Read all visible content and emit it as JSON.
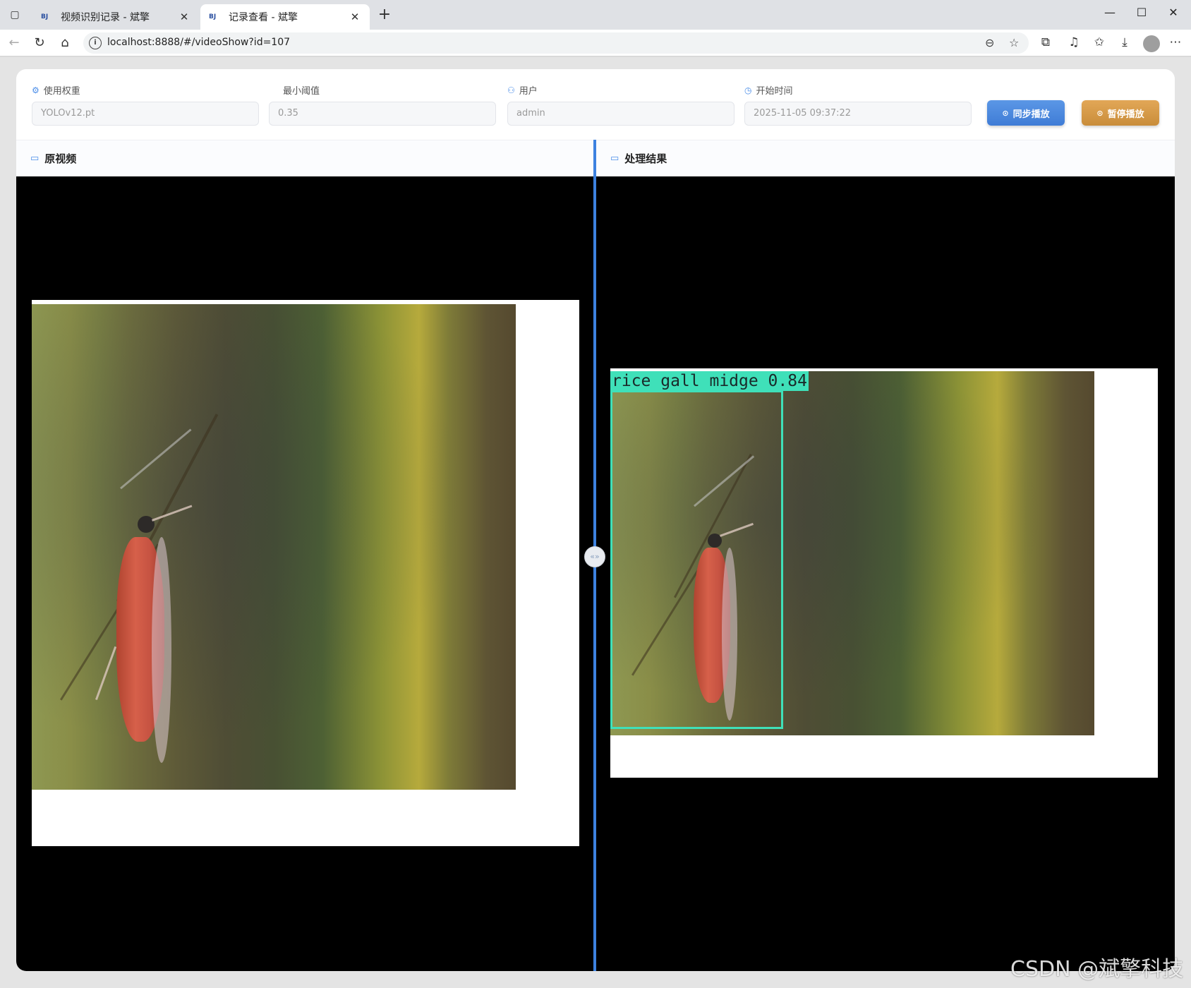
{
  "browser": {
    "tabs": [
      {
        "favicon": "BJ",
        "title": "视频识别记录 - 斌擎",
        "active": false
      },
      {
        "favicon": "BJ",
        "title": "记录查看 - 斌擎",
        "active": true
      }
    ],
    "address": "localhost:8888/#/videoShow?id=107"
  },
  "form": {
    "weight": {
      "label": "使用权重",
      "value": "YOLOv12.pt",
      "icon": "cpu-icon"
    },
    "threshold": {
      "label": "最小阈值",
      "value": "0.35"
    },
    "user": {
      "label": "用户",
      "value": "admin",
      "icon": "user-icon"
    },
    "start_time": {
      "label": "开始时间",
      "value": "2025-11-05 09:37:22",
      "icon": "clock-icon"
    }
  },
  "buttons": {
    "sync": "同步播放",
    "pause": "暂停播放"
  },
  "panels": {
    "original": {
      "title": "原视频",
      "icon": "video-camera-icon"
    },
    "result": {
      "title": "处理结果",
      "icon": "monitor-icon"
    }
  },
  "detection": {
    "label": "rice gall midge 0.84",
    "color": "#3fe0b9"
  },
  "splitter_glyph": "«»",
  "watermark": "CSDN @斌擎科技"
}
